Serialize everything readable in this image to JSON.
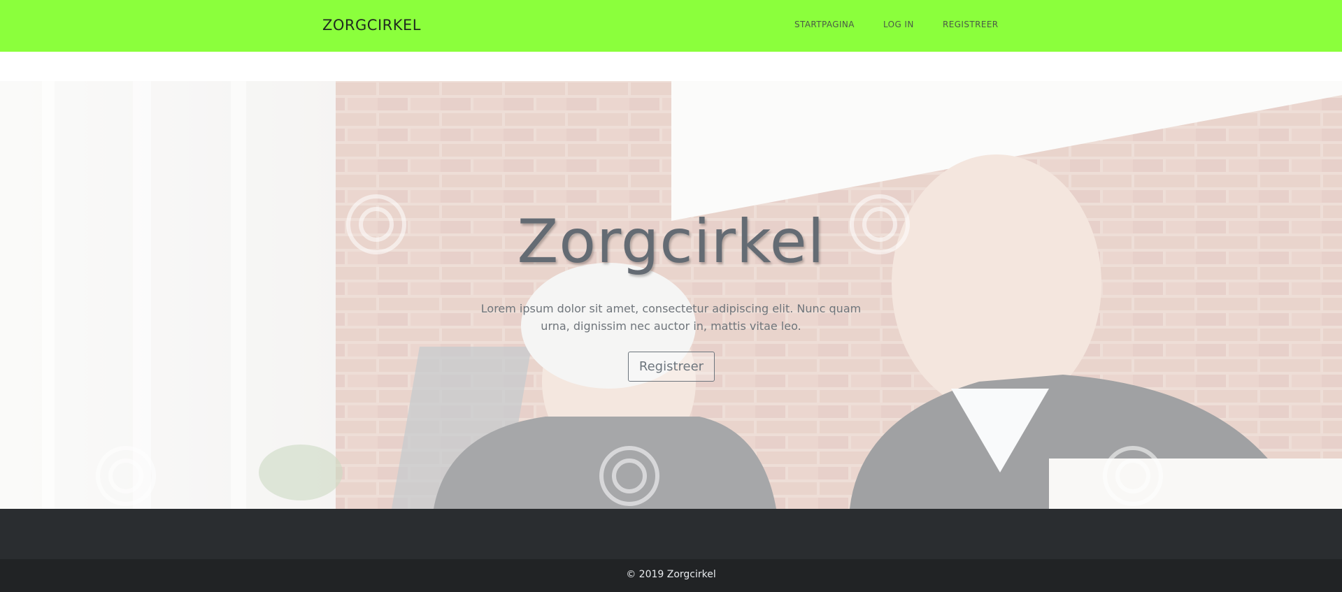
{
  "nav": {
    "brand": "ZORGCIRKEL",
    "links": [
      {
        "label": "STARTPAGINA"
      },
      {
        "label": "LOG IN"
      },
      {
        "label": "REGISTREER"
      }
    ],
    "background": "#8bff3c"
  },
  "hero": {
    "title": "Zorgcirkel",
    "lead_line1": "Lorem ipsum dolor sit amet, consectetur adipiscing elit. Nunc quam",
    "lead_line2": "urna, dignissim nec auctor in, mattis vitae leo.",
    "button_label": "Registreer",
    "image": "faded photo of elderly couple in front of brick wall"
  },
  "footer": {
    "copyright": "© 2019 Zorgcirkel"
  }
}
